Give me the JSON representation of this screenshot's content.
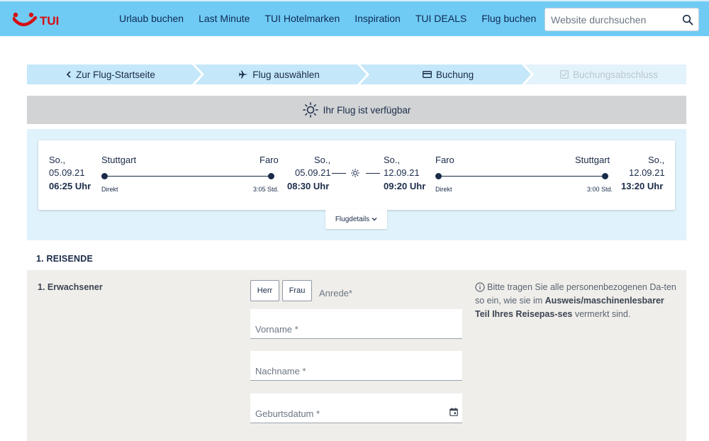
{
  "header": {
    "logo_text": "TUI",
    "nav": [
      "Urlaub buchen",
      "Last Minute",
      "TUI Hotelmarken",
      "Inspiration",
      "TUI DEALS",
      "Flug buchen"
    ],
    "search_placeholder": "Website durchsuchen"
  },
  "stepper": {
    "steps": [
      {
        "label": "Zur Flug-Startseite",
        "icon": "chevron-left-icon"
      },
      {
        "label": "Flug auswählen",
        "icon": "airplane-icon"
      },
      {
        "label": "Buchung",
        "icon": "credit-card-icon"
      },
      {
        "label": "Buchungsabschluss",
        "icon": "checkbox-icon"
      }
    ]
  },
  "availability": {
    "text": "Ihr Flug ist verfügbar",
    "icon": "sun-icon"
  },
  "flight": {
    "outbound": {
      "dep_day": "So.,",
      "dep_date": "05.09.21",
      "dep_time": "06:25 Uhr",
      "from": "Stuttgart",
      "to": "Faro",
      "type": "Direkt",
      "duration": "3:05 Std.",
      "arr_day": "So.,",
      "arr_date": "05.09.21",
      "arr_time": "08:30 Uhr"
    },
    "inbound": {
      "dep_day": "So.,",
      "dep_date": "12.09.21",
      "dep_time": "09:20 Uhr",
      "from": "Faro",
      "to": "Stuttgart",
      "type": "Direkt",
      "duration": "3:00 Std.",
      "arr_day": "So.,",
      "arr_date": "12.09.21",
      "arr_time": "13:20 Uhr"
    },
    "details_label": "Flugdetails"
  },
  "travelers": {
    "section_title": "1. REISENDE",
    "adult_label": "1. Erwachsener",
    "salutation": {
      "options": [
        "Herr",
        "Frau"
      ],
      "label": "Anrede*"
    },
    "fields": {
      "first_name": "Vorname *",
      "last_name": "Nachname *",
      "birth_date": "Geburtsdatum *"
    },
    "info": {
      "part1": "Bitte tragen Sie alle personenbezogenen Da-ten so ein, wie sie im ",
      "bold": "Ausweis/maschinenlesbarer Teil Ihres Reisepas-ses",
      "part2": " vermerkt sind."
    }
  },
  "colors": {
    "header_bg": "#70cbf4",
    "brand_red": "#d40e14",
    "navy": "#1a2b49",
    "stepper_bg": "#c4e7f9",
    "flight_bg": "#e0f2fb",
    "panel_bg": "#f0eeea"
  }
}
